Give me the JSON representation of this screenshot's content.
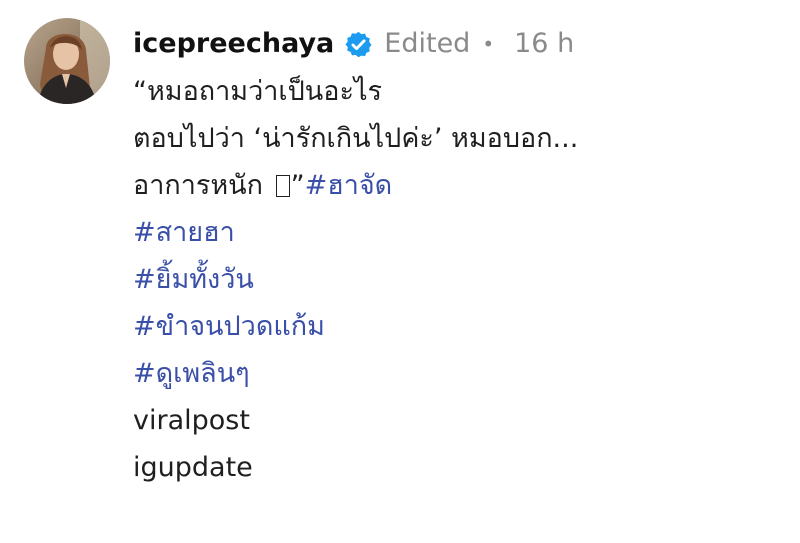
{
  "comment": {
    "username": "icepreechaya",
    "verified_icon": "verified-badge-icon",
    "edited_label": "Edited",
    "separator": "•",
    "time": "16 h",
    "accent_color": "#3a4fa8",
    "muted_color": "#8a8a8a",
    "caption": {
      "line1": "“หมอถามว่าเป็นอะไร",
      "line2": "ตอบไปว่า ‘น่ารักเกินไปค่ะ’ หมอบอก...",
      "line3_text": "อาการหนัก",
      "line3_missing_glyph": "missing-glyph-box-icon",
      "line3_quote": "”",
      "line3_hashtag": "#ฮาจัด",
      "hashtags": [
        "#สายฮา",
        "#ยิ้มทั้งวัน",
        "#ขำจนปวดแก้ม",
        "#ดูเพลินๆ"
      ],
      "plain_tags": [
        "viralpost",
        "igupdate"
      ]
    }
  }
}
